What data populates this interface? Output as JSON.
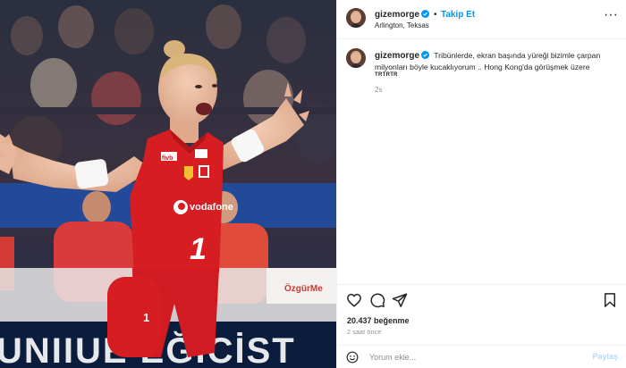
{
  "header": {
    "username": "gizemorge",
    "dot": "•",
    "follow_label": "Takip Et",
    "location": "Arlington, Teksas",
    "more_label": "···"
  },
  "caption": {
    "username": "gizemorge",
    "text": "Tribünlerde, ekran başında yüreği bizimle çarpan milyonları böyle kucaklıyorum .. Hong Kong'da görüşmek üzere",
    "translate_label": "TRTRTR",
    "age": "2s"
  },
  "stats": {
    "likes": "20.437 beğenme",
    "posted": "2 saat önce"
  },
  "comment_box": {
    "placeholder": "Yorum ekle...",
    "post_label": "Paylaş"
  },
  "photo": {
    "jersey_brand": "vodafone",
    "jersey_number": "1",
    "shorts_number": "1",
    "banner_text": "UNIIUE EĞİCİST",
    "board_text": "ÖzgürMe"
  },
  "colors": {
    "accent": "#0095f6",
    "verified": "#0095f6",
    "jersey": "#d61d22",
    "post_disabled": "#b3dbff"
  }
}
